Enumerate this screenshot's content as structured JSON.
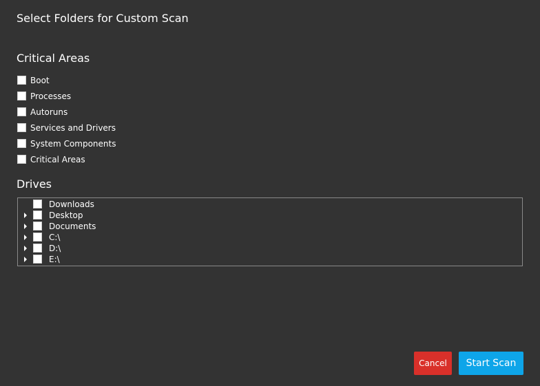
{
  "dialog": {
    "title": "Select Folders for Custom Scan"
  },
  "critical_areas": {
    "heading": "Critical Areas",
    "items": [
      {
        "label": "Boot",
        "checked": false
      },
      {
        "label": "Processes",
        "checked": false
      },
      {
        "label": "Autoruns",
        "checked": false
      },
      {
        "label": "Services and Drivers",
        "checked": false
      },
      {
        "label": "System Components",
        "checked": false
      },
      {
        "label": "Critical Areas",
        "checked": false
      }
    ]
  },
  "drives": {
    "heading": "Drives",
    "items": [
      {
        "label": "Downloads",
        "expandable": false,
        "checked": false
      },
      {
        "label": "Desktop",
        "expandable": true,
        "checked": false
      },
      {
        "label": "Documents",
        "expandable": true,
        "checked": false
      },
      {
        "label": "C:\\",
        "expandable": true,
        "checked": false
      },
      {
        "label": "D:\\",
        "expandable": true,
        "checked": false
      },
      {
        "label": "E:\\",
        "expandable": true,
        "checked": false
      }
    ]
  },
  "buttons": {
    "cancel_label": "Cancel",
    "start_label": "Start Scan"
  },
  "colors": {
    "background": "#333333",
    "cancel": "#d9302a",
    "start": "#0ea5e9",
    "text": "#ffffff"
  }
}
